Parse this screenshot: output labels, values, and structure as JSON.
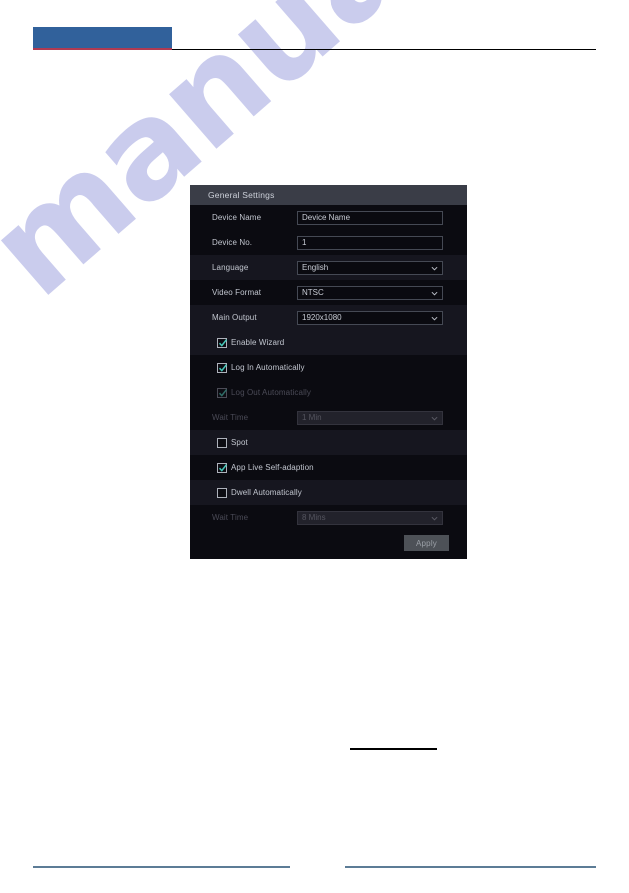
{
  "page": {
    "watermark_text": "manualshive.com",
    "accent_blue": "#31619b",
    "accent_red": "#b03a52",
    "rule_color": "#5c7c96"
  },
  "dialog": {
    "title": "General Settings",
    "fields": [
      {
        "label": "Device Name",
        "value": "Device Name",
        "type": "text",
        "disabled": false
      },
      {
        "label": "Device No.",
        "value": "1",
        "type": "text",
        "disabled": false
      },
      {
        "label": "Language",
        "value": "English",
        "type": "select",
        "disabled": false
      },
      {
        "label": "Video Format",
        "value": "NTSC",
        "type": "select",
        "disabled": false
      },
      {
        "label": "Main Output",
        "value": "1920x1080",
        "type": "select",
        "disabled": false
      }
    ],
    "checkboxes": [
      {
        "label": "Enable Wizard",
        "checked": true,
        "disabled": false
      },
      {
        "label": "Log In Automatically",
        "checked": true,
        "disabled": false
      },
      {
        "label": "Log Out Automatically",
        "checked": true,
        "disabled": true
      },
      {
        "label": "Spot",
        "checked": false,
        "disabled": false
      },
      {
        "label": "App Live Self-adaption",
        "checked": true,
        "disabled": false
      },
      {
        "label": "Dwell Automatically",
        "checked": false,
        "disabled": false
      }
    ],
    "wait_time_logout": {
      "label": "Wait Time",
      "value": "1 Min",
      "disabled": true
    },
    "wait_time_dwell": {
      "label": "Wait Time",
      "value": "8 Mins",
      "disabled": true
    },
    "apply_label": "Apply"
  }
}
